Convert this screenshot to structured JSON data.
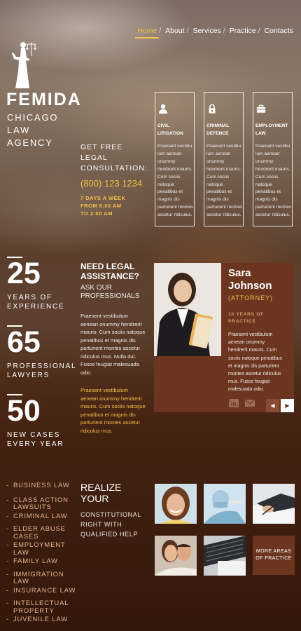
{
  "nav": {
    "items": [
      {
        "label": "Home",
        "sep": "/"
      },
      {
        "label": "About",
        "sep": "/"
      },
      {
        "label": "Services",
        "sep": "/"
      },
      {
        "label": "Practice",
        "sep": "/"
      },
      {
        "label": "Contacts",
        "sep": ""
      }
    ],
    "active": "Home"
  },
  "logo": {
    "title": "FEMIDA",
    "line1": "CHICAGO",
    "line2": "LAW",
    "line3": "AGENCY"
  },
  "consult": {
    "line1": "GET FREE",
    "line2": "LEGAL",
    "line3": "CONSULTATION:",
    "phone": "(800) 123 1234",
    "hours1": "7 DAYS A WEEK",
    "hours2": "FROM 8:00 AM",
    "hours3": "TO 2:00 AM"
  },
  "practice": [
    {
      "title1": "CIVIL",
      "title2": "LITIGATION",
      "icon": "person-icon",
      "desc": [
        "Praesent vestibu",
        "lum aenean",
        "onummy",
        "hendrerit mauris.",
        "Cum sociis",
        "natoque",
        "penatibus et",
        "magnis dis",
        "parturient montes",
        "ascetur ridiculus."
      ]
    },
    {
      "title1": "CRIMINAL",
      "title2": "DEFENCE",
      "icon": "lock-icon",
      "desc": [
        "Praesent vestibu",
        "lum aenean",
        "onummy",
        "hendrerit mauris.",
        "Cum sociis",
        "natoque",
        "penatibus et",
        "magnis dis",
        "parturient montes",
        "ascetur ridiculus."
      ]
    },
    {
      "title1": "EMPLOYMENT",
      "title2": "LAW",
      "icon": "briefcase-icon",
      "desc": [
        "Praesent vestibu",
        "lum aenean",
        "onummy",
        "hendrerit mauris.",
        "Cum sociis",
        "natoque",
        "penatibus et",
        "magnis dis",
        "parturient montes",
        "ascetur ridiculus."
      ]
    }
  ],
  "stats": [
    {
      "number": "25",
      "label1": "YEARS OF",
      "label2": "EXPERIENCE"
    },
    {
      "number": "65",
      "label1": "PROFESSIONAL",
      "label2": "LAWYERS"
    },
    {
      "number": "50",
      "label1": "NEW CASES",
      "label2": "EVERY YEAR"
    }
  ],
  "need": {
    "h1": "NEED LEGAL",
    "h2": "ASSISTANCE?",
    "s1": "ASK OUR",
    "s2": "PROFESSIONALS",
    "p1": [
      "Praesent vestibulum",
      "aenean onummy hendrerit",
      "mauris. Cum sociis natoque",
      "penatibus et magnis dis",
      "parturient montes ascetur",
      "ridiculus mus. Nulla dui.",
      "Fusce feugiat malesuada",
      "odio."
    ],
    "p2": [
      "Praesent vestibulum",
      "aenean onummy hendrerit",
      "mauris. Cum sociis natoque",
      "penatibus et magnis dis",
      "parturient montes ascetur",
      "ridiculus mus."
    ]
  },
  "attorney": {
    "first": "Sara",
    "last": "Johnson",
    "role": "(ATTORNEY)",
    "years1": "10 YEARS OF",
    "years2": "PRACTICE",
    "desc": [
      "Praesent vestibulum",
      "aenean onummy",
      "hendrerit mauris. Cum",
      "sociis natoque penatibus",
      "et magnis dis parturient",
      "montes ascetur ridiculus",
      "mus. Fusce feugiat",
      "malesuada odio."
    ],
    "prev": "◀",
    "next": "▶"
  },
  "areas": [
    "BUSINESS LAW",
    "CLASS ACTION LAWSUITS",
    "CRIMINAL LAW",
    "ELDER ABUSE CASES",
    "EMPLOYMENT LAW",
    "FAMILY LAW",
    "IMMIGRATION LAW",
    "INSURANCE LAW",
    "INTELLECTUAL PROPERTY",
    "JUVENILE LAW"
  ],
  "realize": {
    "h1": "REALIZE",
    "h2": "YOUR",
    "s1": "CONSTITUTIONAL",
    "s2": "RIGHT WITH",
    "s3": "QUALIFIED HELP"
  },
  "more": {
    "line1": "MORE AREAS",
    "line2": "OF PRACTICE"
  },
  "colors": {
    "accent": "#f3c14a",
    "card": "#6b3520",
    "areas": "#e4b495"
  }
}
